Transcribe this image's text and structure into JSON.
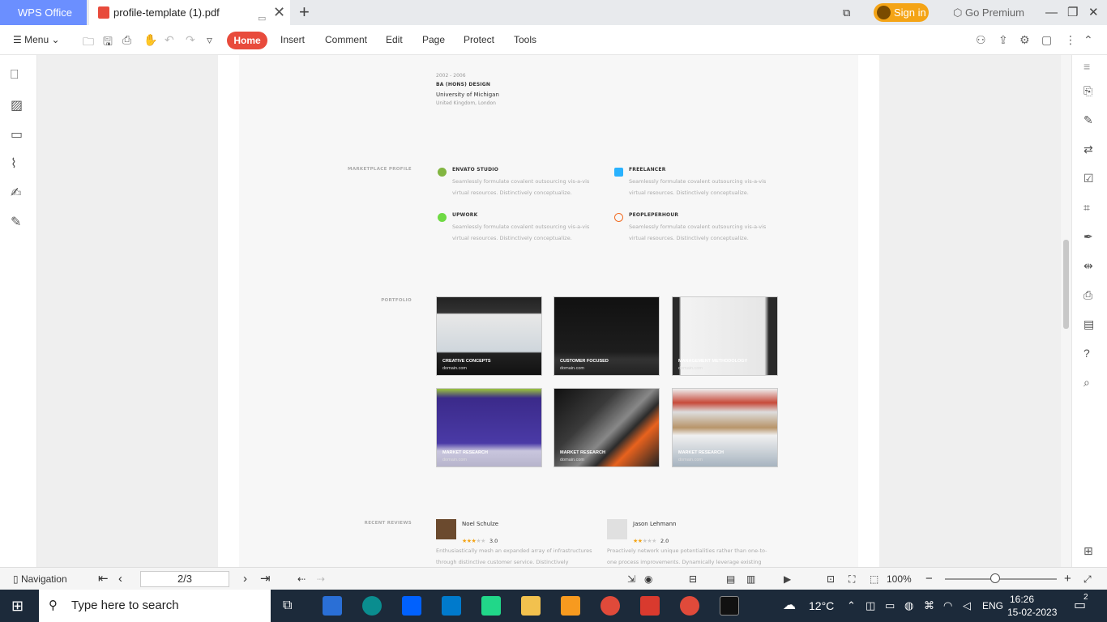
{
  "titlebar": {
    "app_tab": "WPS Office",
    "doc_tab": "profile-template (1).pdf",
    "sign_in": "Sign in",
    "go_premium": "Go Premium"
  },
  "menubar": {
    "menu": "Menu",
    "tabs": [
      "Home",
      "Insert",
      "Comment",
      "Edit",
      "Page",
      "Protect",
      "Tools"
    ]
  },
  "document": {
    "education": {
      "years": "2002 - 2006",
      "degree": "BA (HONS) DESIGN",
      "school": "University of Michigan",
      "location": "United Kingdom, London"
    },
    "marketplace": {
      "label": "MARKETPLACE PROFILE",
      "items": [
        {
          "name": "ENVATO STUDIO",
          "desc1": "Seamlessly formulate covalent outsourcing vis-a-vis",
          "desc2": "virtual resources. Distinctively conceptualize.",
          "color": "#82b541"
        },
        {
          "name": "FREELANCER",
          "desc1": "Seamlessly formulate covalent outsourcing vis-a-vis",
          "desc2": "virtual resources. Distinctively conceptualize.",
          "color": "#29b2fe"
        },
        {
          "name": "UPWORK",
          "desc1": "Seamlessly formulate covalent outsourcing vis-a-vis",
          "desc2": "virtual resources. Distinctively conceptualize.",
          "color": "#6fda44"
        },
        {
          "name": "PEOPLEPERHOUR",
          "desc1": "Seamlessly formulate covalent outsourcing vis-a-vis",
          "desc2": "virtual resources. Distinctively conceptualize.",
          "color": "#f26b21"
        }
      ]
    },
    "portfolio": {
      "label": "PORTFOLIO",
      "items": [
        {
          "caption": "CREATIVE CONCEPTS",
          "domain": "domain.com"
        },
        {
          "caption": "CUSTOMER FOCUSED",
          "domain": "domain.com"
        },
        {
          "caption": "MANAGEMENT METHODOLOGY",
          "domain": "domain.com"
        },
        {
          "caption": "MARKET RESEARCH",
          "domain": "domain.com"
        },
        {
          "caption": "MARKET RESEARCH",
          "domain": "domain.com"
        },
        {
          "caption": "MARKET RESEARCH",
          "domain": "domain.com"
        }
      ]
    },
    "reviews": {
      "label": "RECENT REVIEWS",
      "items": [
        {
          "name": "Noel Schulze",
          "rating": "3.0",
          "stars": 3,
          "text1": "Enthusiastically mesh an expanded array of infrastructures",
          "text2": "through distinctive customer service. Distinctively"
        },
        {
          "name": "Jason Lehmann",
          "rating": "2.0",
          "stars": 2,
          "text1": "Proactively network unique potentialities rather than one-to-",
          "text2": "one process improvements. Dynamically leverage existing"
        }
      ]
    }
  },
  "statusbar": {
    "navigation": "Navigation",
    "page": "2/3",
    "zoom": "100%",
    "zoom_fraction": 0.45
  },
  "taskbar": {
    "search_placeholder": "Type here to search",
    "weather": "12°C",
    "lang": "ENG",
    "time": "16:26",
    "date": "15-02-2023",
    "notif_count": "2"
  }
}
